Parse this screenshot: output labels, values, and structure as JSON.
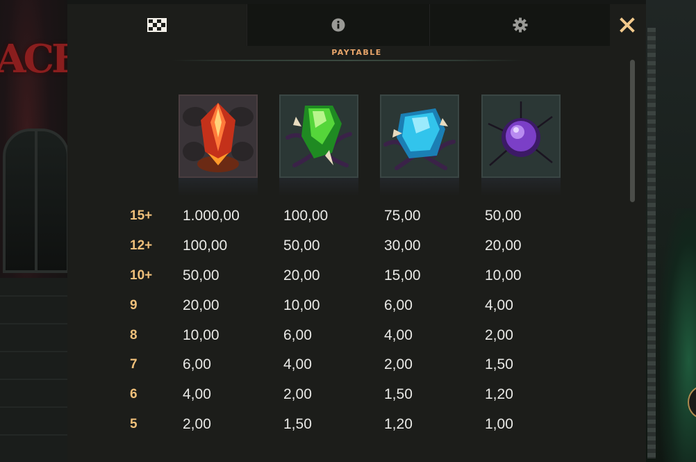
{
  "tabs": [
    {
      "id": "paytable",
      "icon": "checkerboard-icon",
      "active": true
    },
    {
      "id": "info",
      "icon": "info-icon",
      "active": false
    },
    {
      "id": "settings",
      "icon": "gear-icon",
      "active": false
    }
  ],
  "close_icon": "close-icon",
  "title": "PAYTABLE",
  "symbols": [
    {
      "name": "red-gem-icon",
      "color": "#e2421c"
    },
    {
      "name": "green-gem-icon",
      "color": "#34b327"
    },
    {
      "name": "blue-gem-icon",
      "color": "#2fb9e0"
    },
    {
      "name": "purple-gem-icon",
      "color": "#7b3fc7"
    }
  ],
  "paytable": [
    {
      "count": "15+",
      "values": [
        "1.000,00",
        "100,00",
        "75,00",
        "50,00"
      ]
    },
    {
      "count": "12+",
      "values": [
        "100,00",
        "50,00",
        "30,00",
        "20,00"
      ]
    },
    {
      "count": "10+",
      "values": [
        "50,00",
        "20,00",
        "15,00",
        "10,00"
      ]
    },
    {
      "count": "9",
      "values": [
        "20,00",
        "10,00",
        "6,00",
        "4,00"
      ]
    },
    {
      "count": "8",
      "values": [
        "10,00",
        "6,00",
        "4,00",
        "2,00"
      ]
    },
    {
      "count": "7",
      "values": [
        "6,00",
        "4,00",
        "2,00",
        "1,50"
      ]
    },
    {
      "count": "6",
      "values": [
        "4,00",
        "2,00",
        "1,50",
        "1,20"
      ]
    },
    {
      "count": "5",
      "values": [
        "2,00",
        "1,50",
        "1,20",
        "1,00"
      ]
    }
  ],
  "colors": {
    "accent": "#e8a56a",
    "count_text": "#f0c07a",
    "value_text": "#e9e9e6",
    "close": "#f2c98c"
  }
}
